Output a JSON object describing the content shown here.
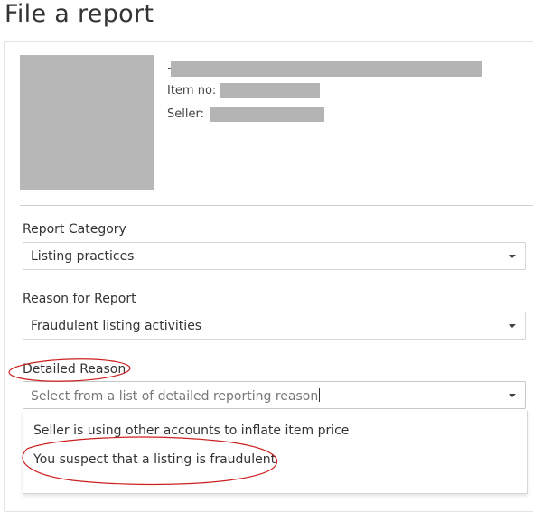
{
  "page": {
    "title": "File a report"
  },
  "item": {
    "item_no_label": "Item no:",
    "seller_label": "Seller:"
  },
  "form": {
    "report_category": {
      "label": "Report Category",
      "value": "Listing practices"
    },
    "reason": {
      "label": "Reason for Report",
      "value": "Fraudulent listing activities"
    },
    "detailed_reason": {
      "label": "Detailed Reason",
      "placeholder": "Select from a list of detailed reporting reason",
      "options": [
        "Seller is using other accounts to inflate item price",
        "You suspect that a listing is fraudulent"
      ]
    }
  },
  "colors": {
    "annotation": "#cc1f1f",
    "redaction": "#b4b4b4"
  }
}
